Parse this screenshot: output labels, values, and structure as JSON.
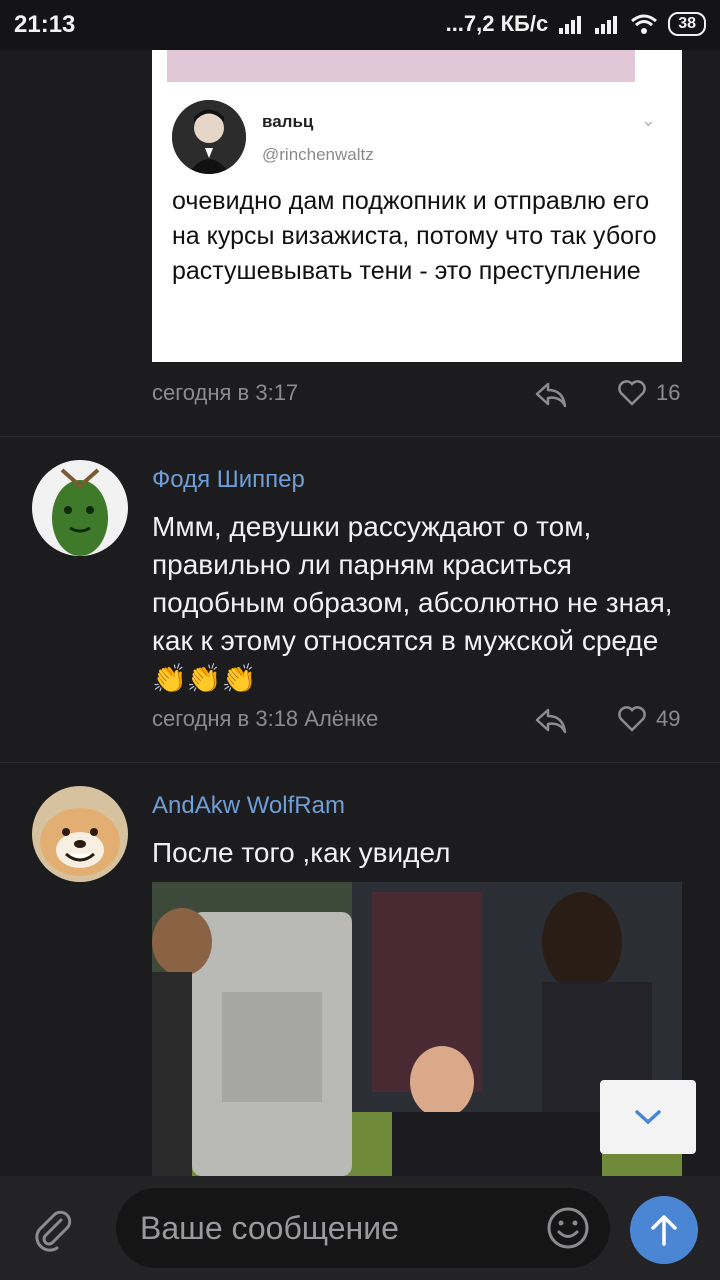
{
  "status": {
    "time": "21:13",
    "network": "...7,2 КБ/с",
    "battery": "38"
  },
  "tweet": {
    "name": "вальц",
    "handle": "@rinchenwaltz",
    "text": "очевидно дам поджопник и отправлю его на курсы визажиста, потому что так убого растушевывать тени - это преступление"
  },
  "comments": [
    {
      "meta": "сегодня в 3:17",
      "likes": "16"
    },
    {
      "author": "Фодя Шиппер",
      "text": "Ммм, девушки рассуждают о том, правильно ли парням краситься подобным образом, абсолютно не зная, как к этому относятся в мужской среде👏👏👏",
      "meta": "сегодня в 3:18 Алёнке",
      "likes": "49"
    },
    {
      "author": "AndAkw WolfRam",
      "text": "После того ,как увидел"
    }
  ],
  "composer": {
    "placeholder": "Ваше сообщение"
  },
  "icons": {
    "reply": "reply-arrow-icon",
    "like": "heart-icon",
    "attach": "paperclip-icon",
    "emoji": "smiley-icon",
    "send": "arrow-up-icon",
    "scroll": "chevron-down-icon"
  },
  "colors": {
    "author": "#6f9ed6",
    "send": "#4a86d4",
    "background": "#1c1c1e"
  }
}
